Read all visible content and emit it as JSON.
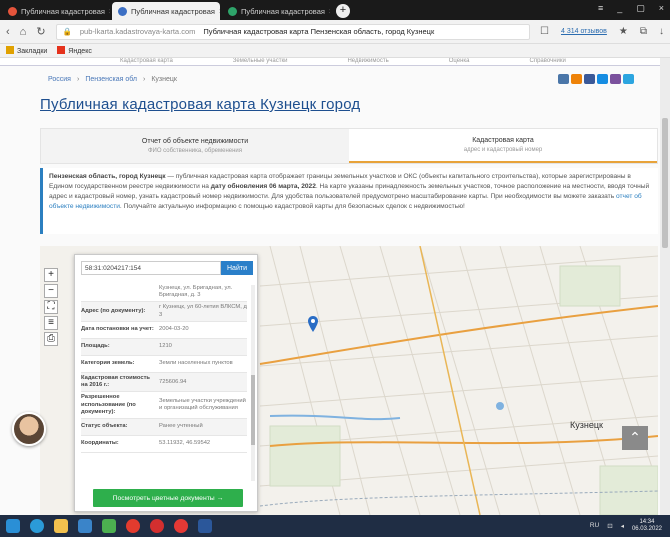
{
  "browser": {
    "tabs": [
      {
        "label": "Публичная кадастровая",
        "color": "#e5543b",
        "active": false
      },
      {
        "label": "Публичная кадастровая",
        "color": "#3c6fc4",
        "active": true
      },
      {
        "label": "Публичная кадастровая",
        "color": "#2ea46a",
        "active": false
      }
    ],
    "url_domain": "pub-lkarta.kadastrovaya-karta.com",
    "url_title": "Публичная кадастровая карта Пензенская область, город Кузнецк",
    "sponsor_label": "4 314 отзывов",
    "bookmarks": [
      {
        "label": "Закладки",
        "color": "#e0a100"
      },
      {
        "label": "Яндекс",
        "color": "#e5321c"
      }
    ]
  },
  "site": {
    "nav": [
      "Кадастровая карта",
      "Земельные участки",
      "Недвижимость",
      "Оценка",
      "Справочники"
    ],
    "breadcrumbs": [
      "Россия",
      "Пензенская обл",
      "Кузнецк"
    ],
    "share_colors": [
      "#4a76a8",
      "#ee8208",
      "#3b5998",
      "#168de2",
      "#7b519d",
      "#2ca5e0"
    ],
    "title": "Публичная кадастровая карта Кузнецк город",
    "info_tabs": [
      {
        "main": "Отчет об объекте недвижимости",
        "sub": "ФИО собственника, обременения",
        "selected": false
      },
      {
        "main": "Кадастровая карта",
        "sub": "адрес и кадастровый номер",
        "selected": true
      }
    ],
    "description_lead": "Пензенская область, город Кузнецк",
    "description_text": " — публичная кадастровая карта отображает границы земельных участков и ОКС (объекты капитального строительства), которые зарегистрированы в Едином государственном реестре недвижимости на ",
    "description_date": "дату обновления 06 марта, 2022",
    "description_rest": ". На карте указаны принадлежность земельных участков, точное расположение на местности, вводя точный адрес и кадастровый номер, узнать кадастровый номер недвижимости. Для удобства пользователей предусмотрено масштабирование карты. При необходимости вы можете заказать ",
    "description_link": "отчет об объекте недвижимости",
    "description_end": ". Получайте актуальную информацию с помощью кадастровой карты для безопасных сделок с недвижимостью!"
  },
  "map": {
    "controls": [
      "+",
      "−",
      "⛶",
      "≡",
      "⎙"
    ],
    "city_label": "Кузнецк",
    "panel": {
      "search_value": "58:31:0204217:154",
      "search_button": "Найти",
      "rows": [
        {
          "k": "",
          "v": "Кузнецк, ул. Бригадная, ул. Бригадная, д. 3"
        },
        {
          "k": "Адрес (по документу):",
          "v": "г Кузнецк, ул 60-летия ВЛКСМ, д 3"
        },
        {
          "k": "Дата постановки на учет:",
          "v": "2004-03-20"
        },
        {
          "k": "Площадь:",
          "v": "1210"
        },
        {
          "k": "Категория земель:",
          "v": "Земли населенных пунктов"
        },
        {
          "k": "Кадастровая стоимость на 2016 г.:",
          "v": "725606.94"
        },
        {
          "k": "Разрешенное использование (по документу):",
          "v": "Земельные участки учреждений и организаций обслуживания"
        },
        {
          "k": "Статус объекта:",
          "v": "Ранее учтенный"
        },
        {
          "k": "Координаты:",
          "v": "53.11932, 46.59542"
        }
      ],
      "docs_button": "Посмотреть цветные документы →"
    }
  },
  "taskbar": {
    "icons": [
      "#2a8fd6",
      "#2b9bd8",
      "#f2c14e",
      "#3a84c9",
      "#4caf50",
      "#e33b2e",
      "#d32f2f",
      "#e53935",
      "#2b579a"
    ],
    "tray": "RU",
    "time": "14:34",
    "date": "06.03.2022"
  }
}
